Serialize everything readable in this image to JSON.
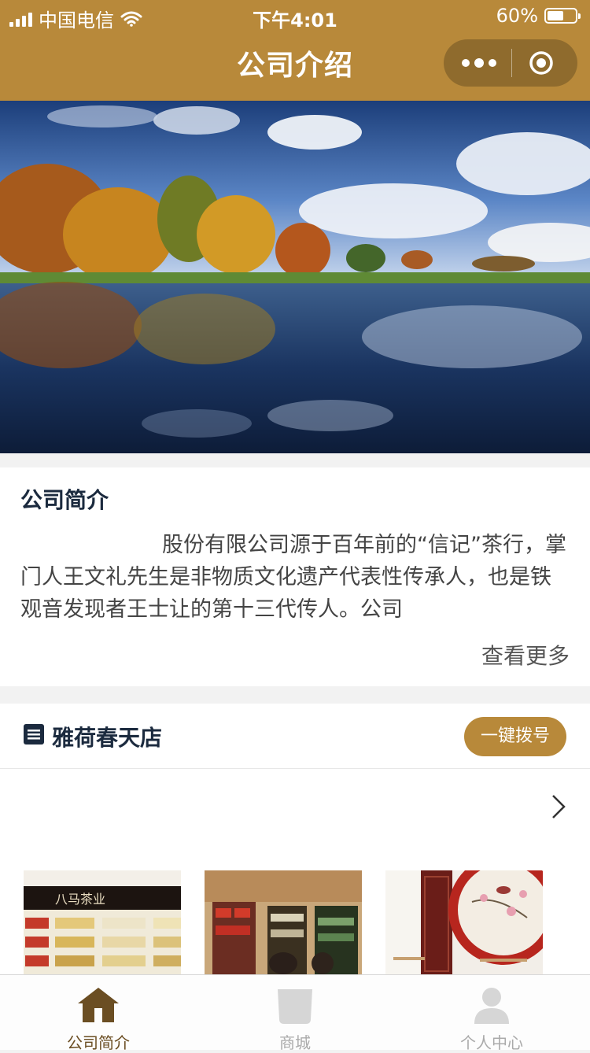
{
  "status_bar": {
    "carrier": "中国电信",
    "time": "下午4:01",
    "battery_text": "60%",
    "battery_level": 0.6
  },
  "nav": {
    "title": "公司介绍",
    "accent_color": "#b8893a"
  },
  "intro": {
    "heading": "公司简介",
    "paragraph": "股份有限公司源于百年前的“信记”茶行，掌门人王文礼先生是非物质文化遗产代表性传承人，也是铁观音发现者王士让的第十三代传人。公司",
    "more_label": "查看更多"
  },
  "store": {
    "name": "雅荷春天店",
    "call_label": "一键拨号",
    "sign_text": "八马茶业"
  },
  "tabs": [
    {
      "label": "公司简介",
      "icon": "home-icon",
      "active": true
    },
    {
      "label": "商城",
      "icon": "bag-icon",
      "active": false
    },
    {
      "label": "个人中心",
      "icon": "person-icon",
      "active": false
    }
  ]
}
